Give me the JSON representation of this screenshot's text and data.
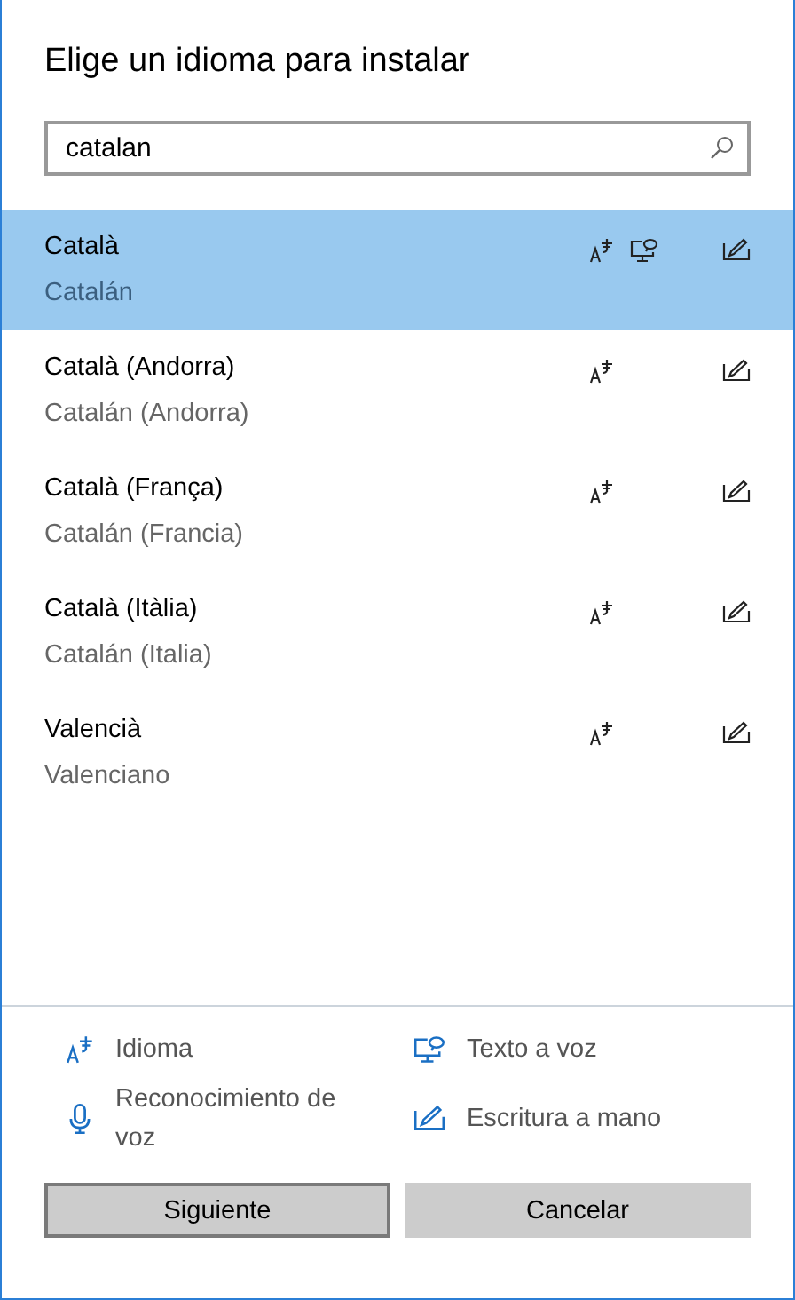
{
  "title": "Elige un idioma para instalar",
  "search": {
    "value": "catalan"
  },
  "languages": [
    {
      "name": "Català",
      "subtitle": "Catalán",
      "selected": true,
      "language": true,
      "speech": true,
      "handwriting": true
    },
    {
      "name": "Català (Andorra)",
      "subtitle": "Catalán (Andorra)",
      "selected": false,
      "language": true,
      "speech": false,
      "handwriting": true
    },
    {
      "name": "Català (França)",
      "subtitle": "Catalán (Francia)",
      "selected": false,
      "language": true,
      "speech": false,
      "handwriting": true
    },
    {
      "name": "Català (Itàlia)",
      "subtitle": "Catalán (Italia)",
      "selected": false,
      "language": true,
      "speech": false,
      "handwriting": true
    },
    {
      "name": "Valencià",
      "subtitle": "Valenciano",
      "selected": false,
      "language": true,
      "speech": false,
      "handwriting": true
    }
  ],
  "legend": [
    {
      "kind": "language",
      "label": "Idioma"
    },
    {
      "kind": "speech",
      "label": "Texto a voz"
    },
    {
      "kind": "recognition",
      "label": "Reconocimiento de voz"
    },
    {
      "kind": "handwriting",
      "label": "Escritura a mano"
    }
  ],
  "buttons": [
    {
      "label": "Siguiente",
      "default": true
    },
    {
      "label": "Cancelar",
      "default": false
    }
  ]
}
